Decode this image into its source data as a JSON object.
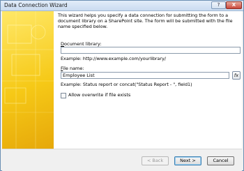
{
  "window": {
    "title": "Data Connection Wizard",
    "help": "?",
    "close": "X"
  },
  "intro": "This wizard helps you specify a data connection for submitting the form to a document library on a SharePoint site. The form will be submitted with the file name specified below.",
  "document_library": {
    "label_accel": "D",
    "label_rest": "ocument library:",
    "value": "",
    "example": "Example: http://www.example.com/yourlibrary/"
  },
  "file_name": {
    "label_accel": "F",
    "label_rest": "ile name:",
    "value": "Employee List",
    "example": "Example: Status report or concat(\"Status Report - \", field1)",
    "fx": "fx"
  },
  "overwrite": {
    "label": "Allow overwrite if file exists",
    "checked": false
  },
  "buttons": {
    "back": "< Back",
    "next": "Next >",
    "cancel": "Cancel"
  }
}
